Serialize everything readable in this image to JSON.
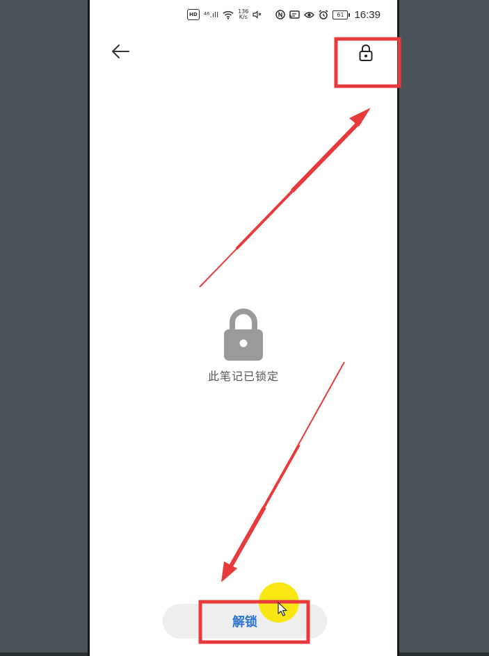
{
  "status_bar": {
    "hd_badge": "HD",
    "signal": "⁴⁶.ıll",
    "speed_value": "136",
    "speed_unit": "K/s",
    "battery": "61",
    "time": "16:39"
  },
  "top_bar": {
    "back_icon": "arrow-left-icon",
    "lock_icon": "lock-icon"
  },
  "locked_panel": {
    "icon": "padlock-icon",
    "message": "此笔记已锁定"
  },
  "actions": {
    "unlock_label": "解锁"
  },
  "colors": {
    "accent": "#2a72d8",
    "annotation_red": "#e83a3a",
    "lock_gray": "#9a9a9a",
    "click_highlight": "#f8e600",
    "backdrop": "#4a5358"
  }
}
